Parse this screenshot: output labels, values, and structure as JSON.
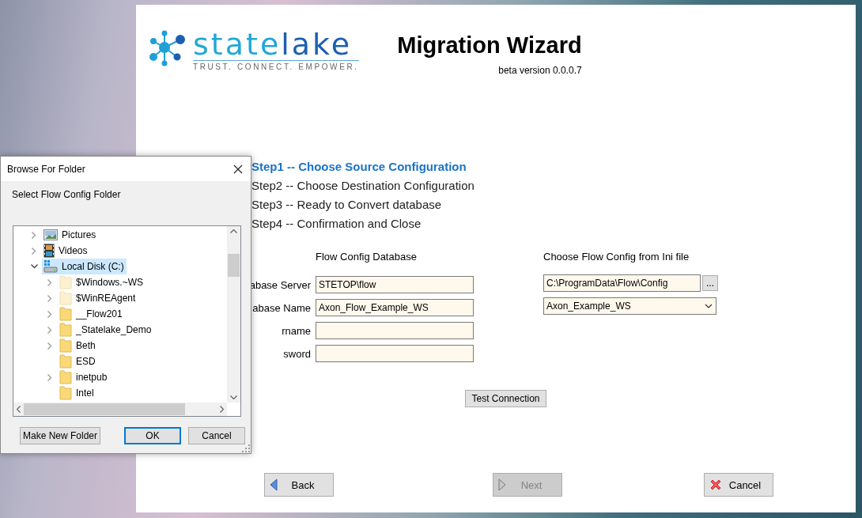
{
  "wizard": {
    "logo": {
      "wordmark": [
        "state",
        "lake"
      ],
      "tagline": "TRUST. CONNECT. EMPOWER."
    },
    "title": "Migration Wizard",
    "version": "beta version 0.0.0.7",
    "steps": [
      {
        "label": "Step1 -- Choose Source Configuration",
        "selected": true
      },
      {
        "label": "Step2 -- Choose Destination Configuration",
        "selected": false
      },
      {
        "label": "Step3 -- Ready to Convert database",
        "selected": false
      },
      {
        "label": "Step4 -- Confirmation and Close",
        "selected": false
      }
    ],
    "database": {
      "heading": "Flow Config Database",
      "fields": [
        {
          "label": "abase Server",
          "value": "STETOP\\flow"
        },
        {
          "label": "abase Name",
          "value": "Axon_Flow_Example_WS"
        },
        {
          "label": "rname"
        },
        {
          "label": "sword"
        }
      ]
    },
    "ini": {
      "heading": "Choose Flow Config from Ini file",
      "path": "C:\\ProgramData\\Flow\\Config",
      "browse_button": "...",
      "dropdown": "Axon_Example_WS"
    },
    "test_button": "Test Connection",
    "nav_buttons": [
      {
        "label": "Back",
        "kind": "back",
        "disabled": false
      },
      {
        "label": "Next",
        "kind": "next",
        "disabled": true
      },
      {
        "label": "Cancel",
        "kind": "cancel",
        "disabled": false
      }
    ]
  },
  "dialog": {
    "title": "Browse For Folder",
    "prompt": "Select Flow Config Folder",
    "tree": [
      {
        "label": "Pictures",
        "kind": "pictures",
        "expandable": true,
        "expanded": false,
        "selected": false
      },
      {
        "label": "Videos",
        "kind": "videos",
        "expandable": true,
        "expanded": false,
        "selected": false
      },
      {
        "label": "Local Disk (C:)",
        "kind": "drive",
        "expandable": true,
        "expanded": true,
        "selected": true,
        "children": [
          {
            "label": "$Windows.~WS",
            "kind": "folder",
            "expandable": true,
            "hidden": true,
            "selected": false
          },
          {
            "label": "$WinREAgent",
            "kind": "folder",
            "expandable": true,
            "hidden": true,
            "selected": false
          },
          {
            "label": "__Flow201",
            "kind": "folder",
            "expandable": true,
            "hidden": false,
            "selected": false
          },
          {
            "label": "_Statelake_Demo",
            "kind": "folder",
            "expandable": true,
            "hidden": false,
            "selected": false
          },
          {
            "label": "Beth",
            "kind": "folder",
            "expandable": true,
            "hidden": false,
            "selected": false
          },
          {
            "label": "ESD",
            "kind": "folder",
            "expandable": false,
            "hidden": false,
            "selected": false
          },
          {
            "label": "inetpub",
            "kind": "folder",
            "expandable": true,
            "hidden": false,
            "selected": false
          },
          {
            "label": "Intel",
            "kind": "folder",
            "expandable": false,
            "hidden": false,
            "selected": false
          }
        ]
      }
    ],
    "buttons": [
      {
        "label": "Make New Folder",
        "focused": false
      },
      {
        "label": "OK",
        "focused": true
      },
      {
        "label": "Cancel",
        "focused": false
      }
    ]
  }
}
